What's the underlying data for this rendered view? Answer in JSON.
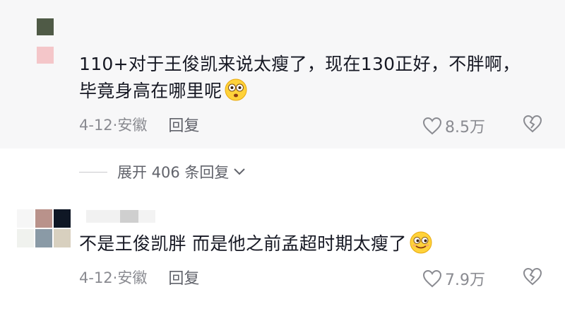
{
  "comments": [
    {
      "text": "110+对于王俊凯来说太瘦了，现在130正好，不胖啊，毕竟身高在哪里呢",
      "emoji": "flushed-face",
      "date_location": "4-12·安徽",
      "reply_label": "回复",
      "likes": "8.5万"
    },
    {
      "text": "不是王俊凯胖 而是他之前孟超时期太瘦了",
      "emoji": "smiling-face",
      "date_location": "4-12·安徽",
      "reply_label": "回复",
      "likes": "7.9万"
    }
  ],
  "expand_replies": {
    "label": "展开 406 条回复"
  },
  "colors": {
    "highlight_bg": "#f7f7f8",
    "text": "#161823",
    "meta": "#8a8b91",
    "avatar1_top": "#4f5a46",
    "avatar1_bottom": "#f4c6c9",
    "avatar2_tiles": [
      "#f6f6f6",
      "#b9928b",
      "#0f1725",
      "#f0f2ee",
      "#8a9aa6",
      "#d8d0bf"
    ]
  }
}
